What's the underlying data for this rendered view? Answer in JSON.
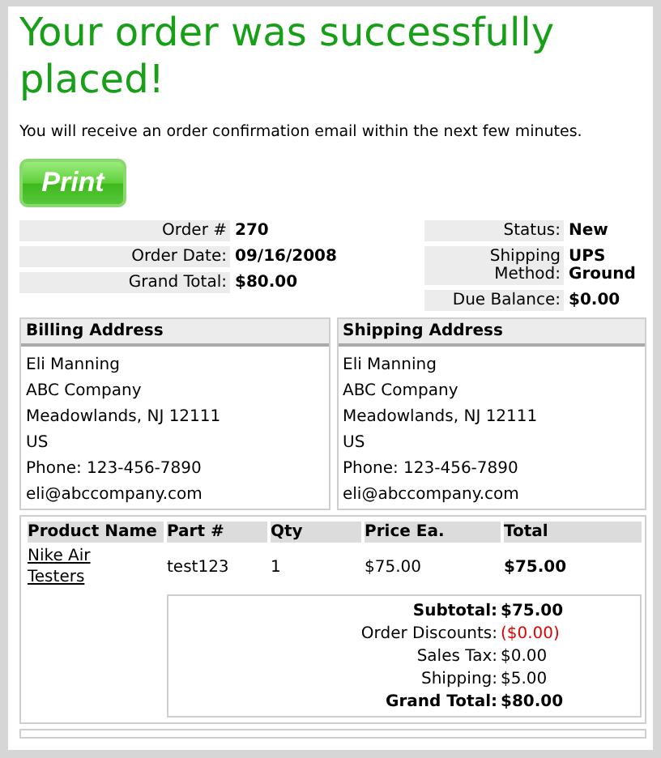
{
  "heading": "Your order was successfully placed!",
  "message": "You will receive an order confirmation email within the next few minutes.",
  "print_button": "Print",
  "order_info": [
    {
      "label": "Order #",
      "value": "270"
    },
    {
      "label": "Order Date:",
      "value": "09/16/2008"
    },
    {
      "label": "Grand Total:",
      "value": "$80.00"
    }
  ],
  "order_status": [
    {
      "label": "Status:",
      "value": "New"
    },
    {
      "label": "Shipping Method:",
      "value": "UPS Ground"
    },
    {
      "label": "Due Balance:",
      "value": "$0.00"
    }
  ],
  "addresses": [
    {
      "title": "Billing Address",
      "lines": [
        "Eli Manning",
        "ABC Company",
        "Meadowlands, NJ 12111",
        "US",
        "Phone: 123-456-7890",
        "eli@abccompany.com"
      ]
    },
    {
      "title": "Shipping Address",
      "lines": [
        "Eli Manning",
        "ABC Company",
        "Meadowlands, NJ 12111",
        "US",
        "Phone: 123-456-7890",
        "eli@abccompany.com"
      ]
    }
  ],
  "items": {
    "columns": [
      "Product Name",
      "Part #",
      "Qty",
      "Price Ea.",
      "Total"
    ],
    "rows": [
      {
        "product": "Nike Air Testers",
        "part": "test123",
        "qty": "1",
        "price": "$75.00",
        "total": "$75.00"
      }
    ]
  },
  "totals": [
    {
      "kind": "bold",
      "label": "Subtotal:",
      "value": "$75.00"
    },
    {
      "kind": "negative",
      "label": "Order Discounts:",
      "value": "($0.00)"
    },
    {
      "kind": "plain",
      "label": "Sales Tax:",
      "value": "$0.00"
    },
    {
      "kind": "plain",
      "label": "Shipping:",
      "value": "$5.00"
    },
    {
      "kind": "bold",
      "label": "Grand Total:",
      "value": "$80.00"
    }
  ]
}
